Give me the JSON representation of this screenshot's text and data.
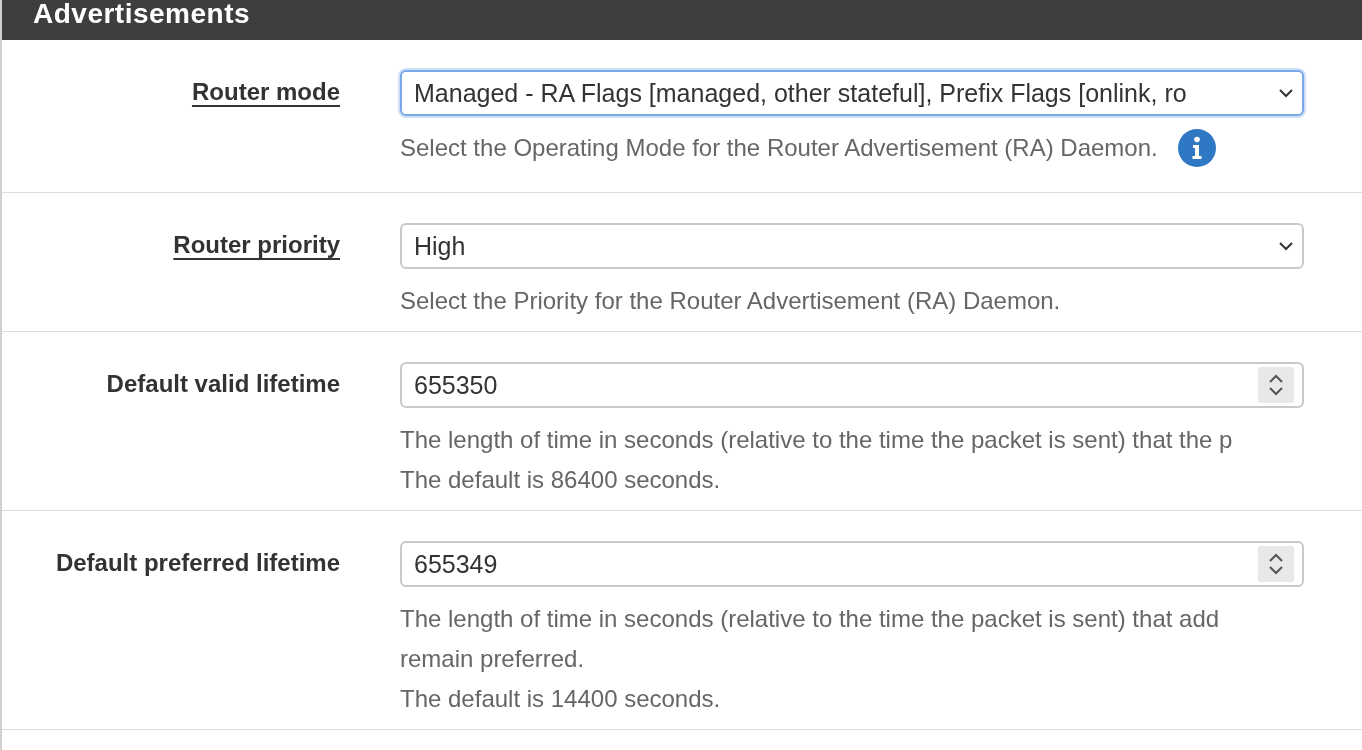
{
  "section": {
    "title": "Advertisements"
  },
  "fields": [
    {
      "kind": "select",
      "label": "Router mode",
      "underlined": true,
      "value": "Managed - RA Flags [managed, other stateful], Prefix Flags [onlink, ro",
      "focused": true,
      "info": true,
      "help": [
        "Select the Operating Mode for the Router Advertisement (RA) Daemon."
      ]
    },
    {
      "kind": "select",
      "label": "Router priority",
      "underlined": true,
      "value": "High",
      "focused": false,
      "info": false,
      "help": [
        "Select the Priority for the Router Advertisement (RA) Daemon."
      ]
    },
    {
      "kind": "number",
      "label": "Default valid lifetime",
      "underlined": false,
      "value": "655350",
      "focused": false,
      "info": false,
      "help": [
        "The length of time in seconds (relative to the time the packet is sent) that the p",
        "The default is 86400 seconds."
      ]
    },
    {
      "kind": "number",
      "label": "Default preferred lifetime",
      "underlined": false,
      "value": "655349",
      "focused": false,
      "info": false,
      "help": [
        "The length of time in seconds (relative to the time the packet is sent) that add",
        "remain preferred.",
        "The default is 14400 seconds."
      ]
    }
  ]
}
